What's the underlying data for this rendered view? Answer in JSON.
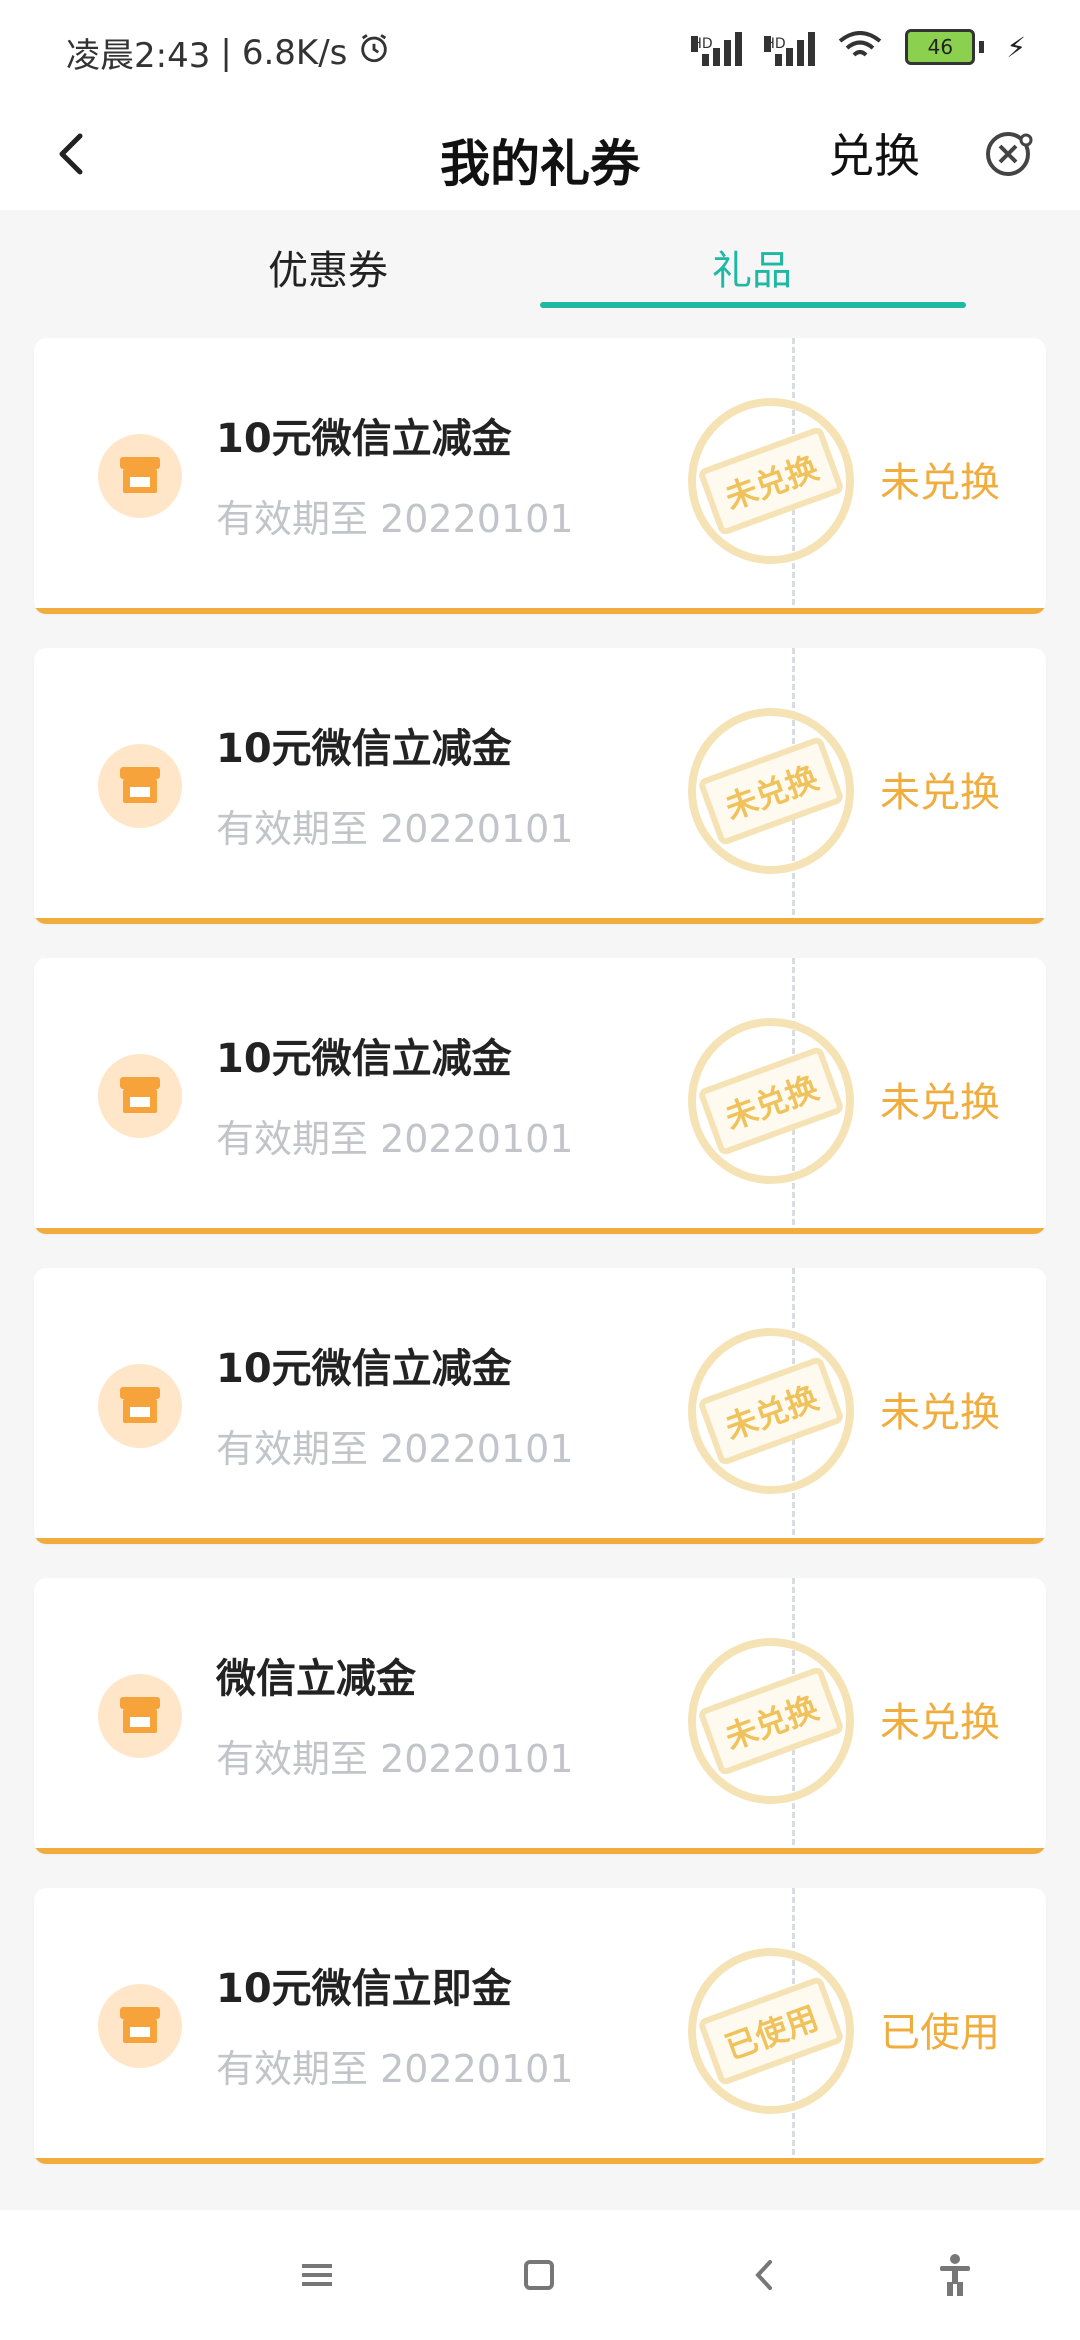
{
  "status": {
    "time": "凌晨2:43",
    "speed": "6.8K/s",
    "battery": "46"
  },
  "header": {
    "title": "我的礼券",
    "exchange": "兑换"
  },
  "tabs": [
    {
      "label": "优惠券",
      "active": false
    },
    {
      "label": "礼品",
      "active": true
    }
  ],
  "cards": [
    {
      "title": "10元微信立减金",
      "expiry": "有效期至 20220101",
      "stamp": "未兑换",
      "status": "未兑换"
    },
    {
      "title": "10元微信立减金",
      "expiry": "有效期至 20220101",
      "stamp": "未兑换",
      "status": "未兑换"
    },
    {
      "title": "10元微信立减金",
      "expiry": "有效期至 20220101",
      "stamp": "未兑换",
      "status": "未兑换"
    },
    {
      "title": "10元微信立减金",
      "expiry": "有效期至 20220101",
      "stamp": "未兑换",
      "status": "未兑换"
    },
    {
      "title": "微信立减金",
      "expiry": "有效期至 20220101",
      "stamp": "未兑换",
      "status": "未兑换"
    },
    {
      "title": "10元微信立即金",
      "expiry": "有效期至 20220101",
      "stamp": "已使用",
      "status": "已使用"
    }
  ],
  "colors": {
    "accent": "#1fb8a3",
    "orange": "#f0ad3e",
    "stamp": "#f0c25c"
  }
}
